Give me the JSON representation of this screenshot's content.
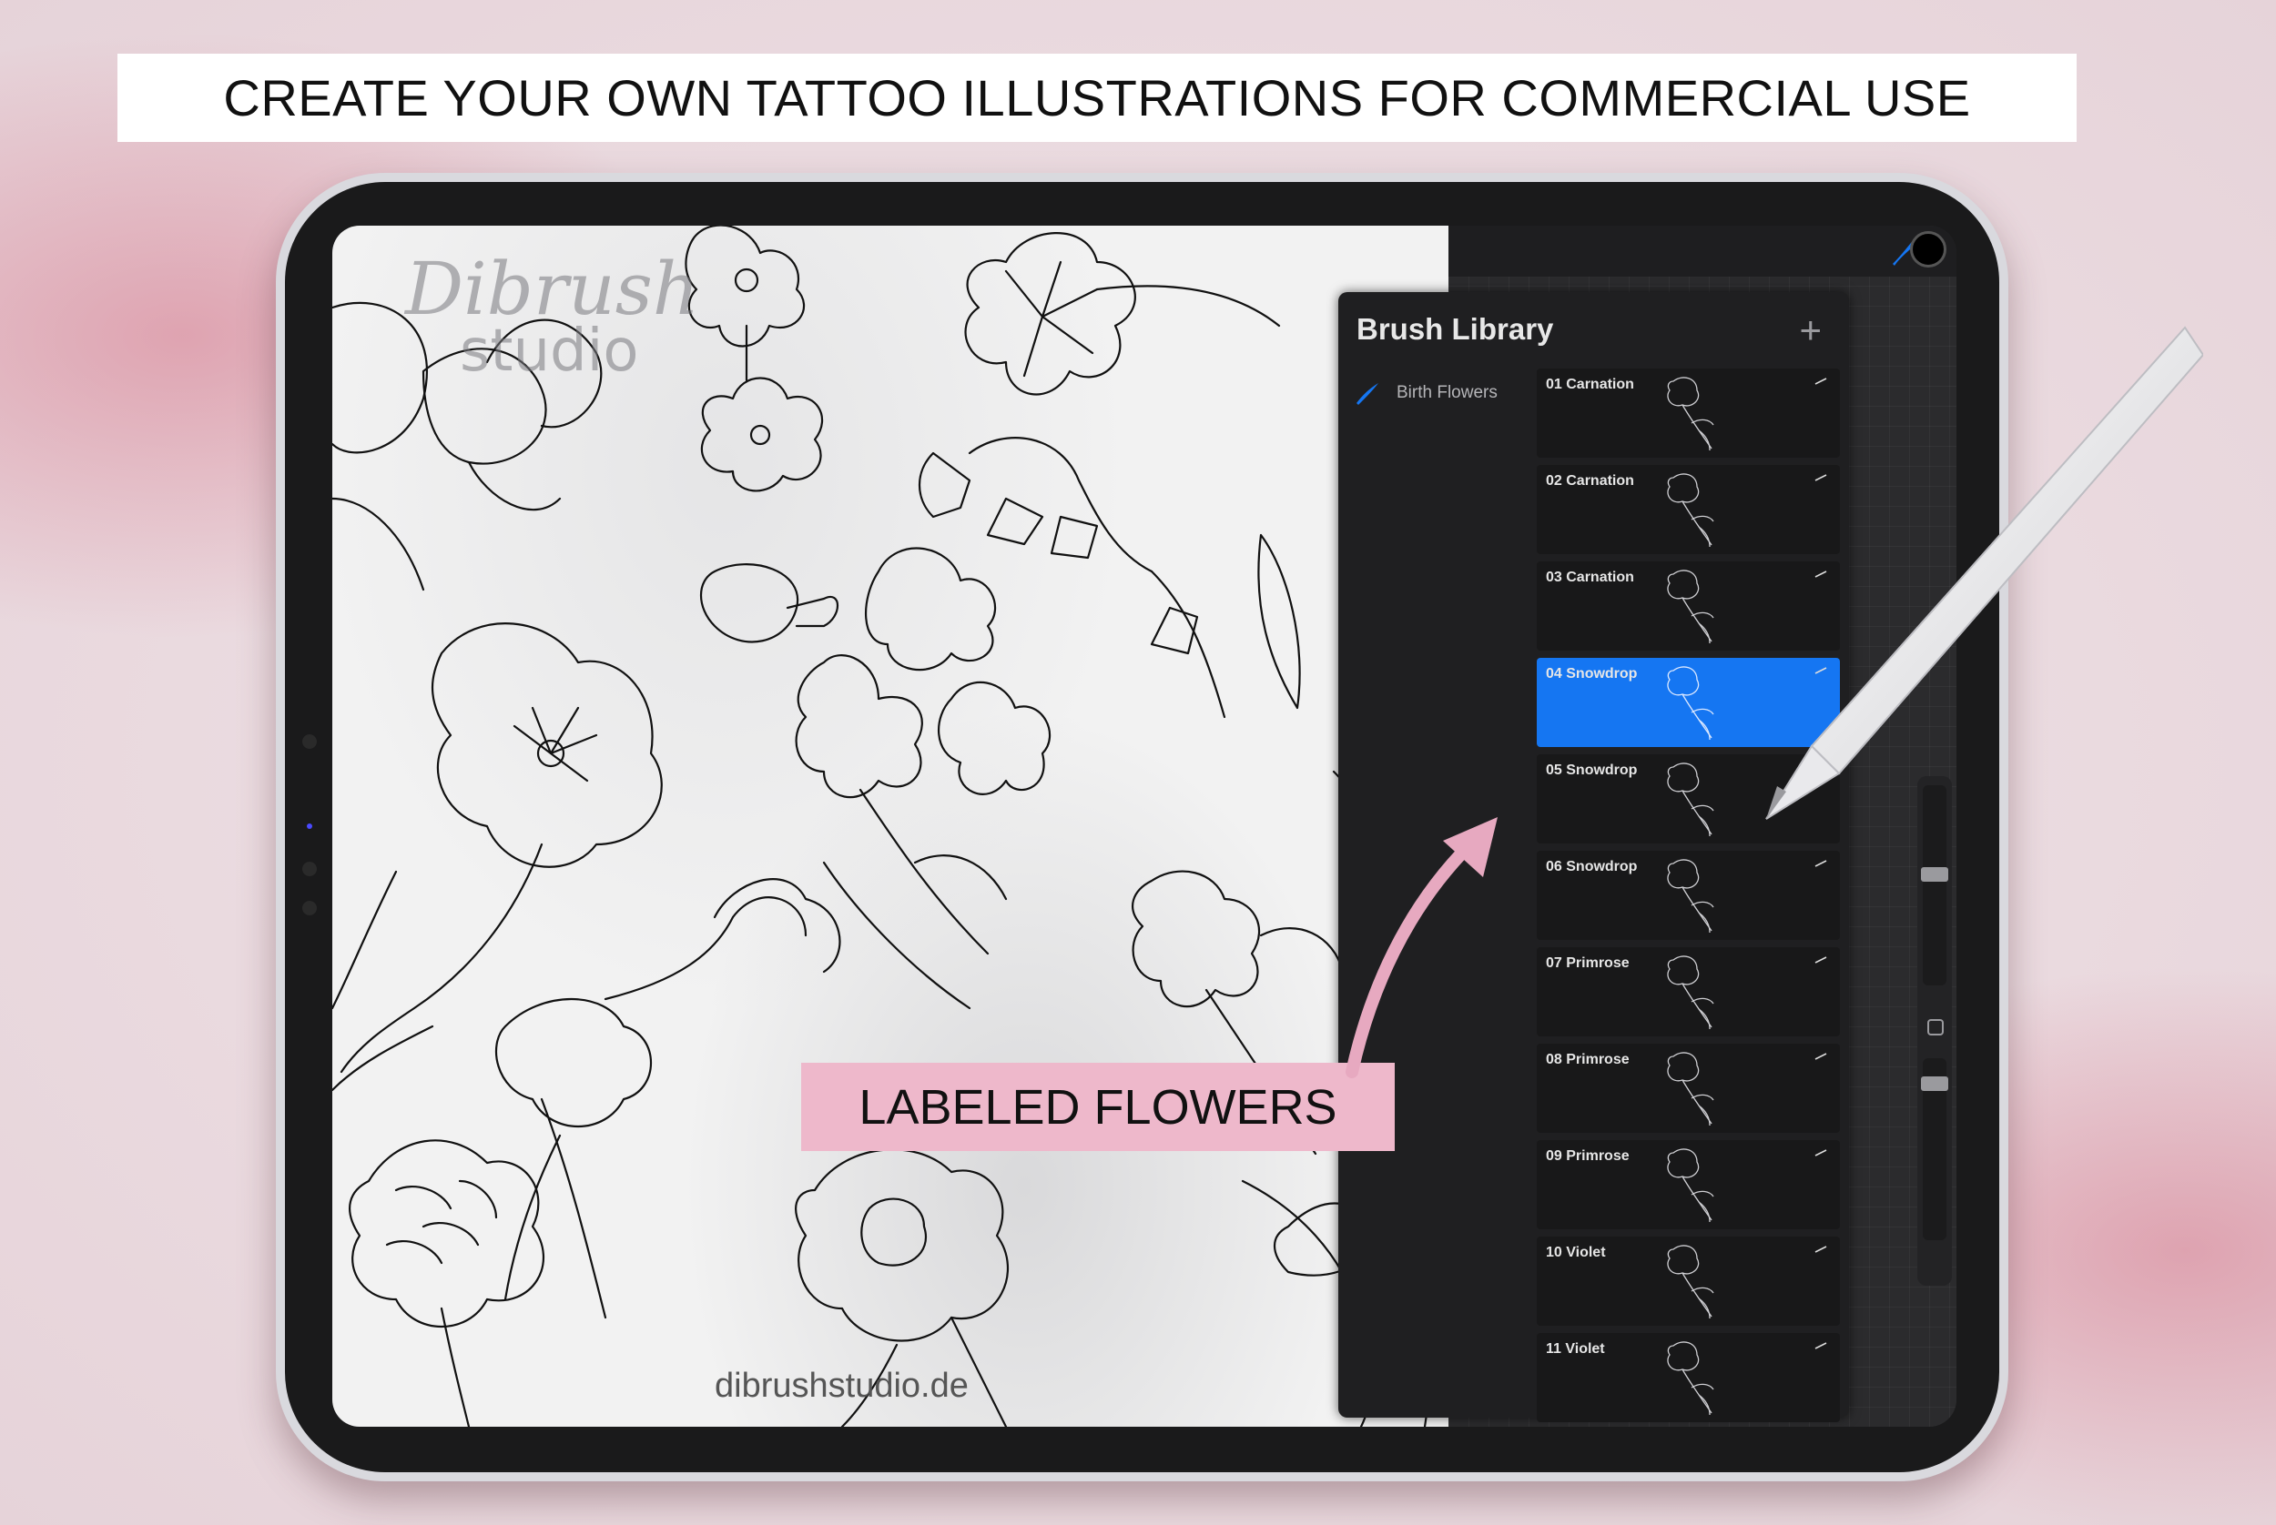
{
  "banner": {
    "text": "CREATE YOUR OWN TATTOO ILLUSTRATIONS FOR COMMERCIAL USE"
  },
  "canvas": {
    "watermark_logo": "Dibrush",
    "watermark_sub": "studio",
    "site": "dibrushstudio.de"
  },
  "toolbar": {
    "icons": [
      "brush-icon",
      "smudge-icon",
      "eraser-icon",
      "layers-icon"
    ],
    "color": "#000000",
    "accent": "#1576f2"
  },
  "brush_library": {
    "title": "Brush Library",
    "add_symbol": "+",
    "set_name": "Birth Flowers",
    "brushes": [
      {
        "name": "01 Carnation",
        "selected": false
      },
      {
        "name": "02 Carnation",
        "selected": false
      },
      {
        "name": "03 Carnation",
        "selected": false
      },
      {
        "name": "04 Snowdrop",
        "selected": true
      },
      {
        "name": "05 Snowdrop",
        "selected": false
      },
      {
        "name": "06 Snowdrop",
        "selected": false
      },
      {
        "name": "07 Primrose",
        "selected": false
      },
      {
        "name": "08 Primrose",
        "selected": false
      },
      {
        "name": "09 Primrose",
        "selected": false
      },
      {
        "name": "10 Violet",
        "selected": false
      },
      {
        "name": "11 Violet",
        "selected": false
      }
    ]
  },
  "callout": {
    "text": "LABELED FLOWERS",
    "color": "#eeb8cb"
  },
  "arrow_color": "#e7a9c0"
}
